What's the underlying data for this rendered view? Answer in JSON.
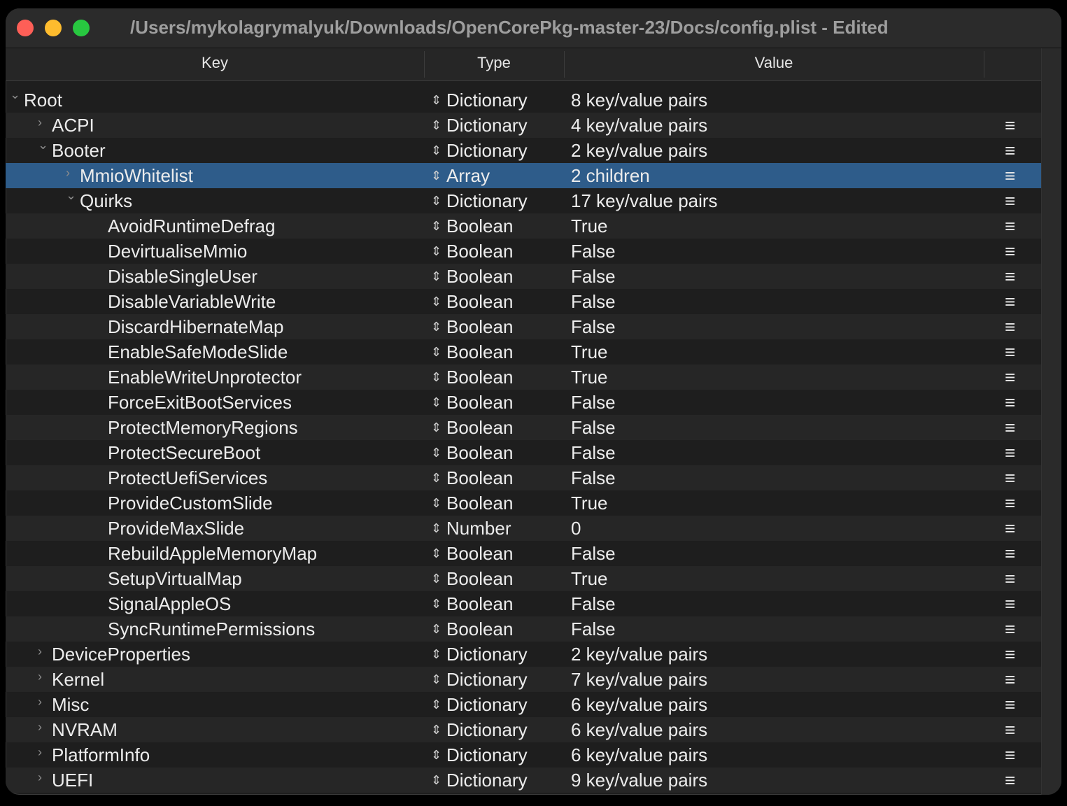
{
  "window": {
    "title": "/Users/mykolagrymalyuk/Downloads/OpenCorePkg-master-23/Docs/config.plist - Edited"
  },
  "columns": {
    "key": "Key",
    "type": "Type",
    "value": "Value"
  },
  "stepper_glyph": "⇕",
  "menu_glyph": "≡",
  "rows": [
    {
      "key": "Root",
      "type": "Dictionary",
      "value": "8 key/value pairs",
      "level": 0,
      "chevron": "⌄",
      "menu": false
    },
    {
      "key": "ACPI",
      "type": "Dictionary",
      "value": "4 key/value pairs",
      "level": 1,
      "chevron": "›",
      "menu": true
    },
    {
      "key": "Booter",
      "type": "Dictionary",
      "value": "2 key/value pairs",
      "level": 1,
      "chevron": "⌄",
      "menu": true
    },
    {
      "key": "MmioWhitelist",
      "type": "Array",
      "value": "2 children",
      "level": 2,
      "chevron": "›",
      "menu": true,
      "selected": true
    },
    {
      "key": "Quirks",
      "type": "Dictionary",
      "value": "17 key/value pairs",
      "level": 2,
      "chevron": "⌄",
      "menu": true
    },
    {
      "key": "AvoidRuntimeDefrag",
      "type": "Boolean",
      "value": "True",
      "level": 3,
      "chevron": "",
      "menu": true
    },
    {
      "key": "DevirtualiseMmio",
      "type": "Boolean",
      "value": "False",
      "level": 3,
      "chevron": "",
      "menu": true
    },
    {
      "key": "DisableSingleUser",
      "type": "Boolean",
      "value": "False",
      "level": 3,
      "chevron": "",
      "menu": true
    },
    {
      "key": "DisableVariableWrite",
      "type": "Boolean",
      "value": "False",
      "level": 3,
      "chevron": "",
      "menu": true
    },
    {
      "key": "DiscardHibernateMap",
      "type": "Boolean",
      "value": "False",
      "level": 3,
      "chevron": "",
      "menu": true
    },
    {
      "key": "EnableSafeModeSlide",
      "type": "Boolean",
      "value": "True",
      "level": 3,
      "chevron": "",
      "menu": true
    },
    {
      "key": "EnableWriteUnprotector",
      "type": "Boolean",
      "value": "True",
      "level": 3,
      "chevron": "",
      "menu": true
    },
    {
      "key": "ForceExitBootServices",
      "type": "Boolean",
      "value": "False",
      "level": 3,
      "chevron": "",
      "menu": true
    },
    {
      "key": "ProtectMemoryRegions",
      "type": "Boolean",
      "value": "False",
      "level": 3,
      "chevron": "",
      "menu": true
    },
    {
      "key": "ProtectSecureBoot",
      "type": "Boolean",
      "value": "False",
      "level": 3,
      "chevron": "",
      "menu": true
    },
    {
      "key": "ProtectUefiServices",
      "type": "Boolean",
      "value": "False",
      "level": 3,
      "chevron": "",
      "menu": true
    },
    {
      "key": "ProvideCustomSlide",
      "type": "Boolean",
      "value": "True",
      "level": 3,
      "chevron": "",
      "menu": true
    },
    {
      "key": "ProvideMaxSlide",
      "type": "Number",
      "value": "0",
      "level": 3,
      "chevron": "",
      "menu": true
    },
    {
      "key": "RebuildAppleMemoryMap",
      "type": "Boolean",
      "value": "False",
      "level": 3,
      "chevron": "",
      "menu": true
    },
    {
      "key": "SetupVirtualMap",
      "type": "Boolean",
      "value": "True",
      "level": 3,
      "chevron": "",
      "menu": true
    },
    {
      "key": "SignalAppleOS",
      "type": "Boolean",
      "value": "False",
      "level": 3,
      "chevron": "",
      "menu": true
    },
    {
      "key": "SyncRuntimePermissions",
      "type": "Boolean",
      "value": "False",
      "level": 3,
      "chevron": "",
      "menu": true
    },
    {
      "key": "DeviceProperties",
      "type": "Dictionary",
      "value": "2 key/value pairs",
      "level": 1,
      "chevron": "›",
      "menu": true
    },
    {
      "key": "Kernel",
      "type": "Dictionary",
      "value": "7 key/value pairs",
      "level": 1,
      "chevron": "›",
      "menu": true
    },
    {
      "key": "Misc",
      "type": "Dictionary",
      "value": "6 key/value pairs",
      "level": 1,
      "chevron": "›",
      "menu": true
    },
    {
      "key": "NVRAM",
      "type": "Dictionary",
      "value": "6 key/value pairs",
      "level": 1,
      "chevron": "›",
      "menu": true
    },
    {
      "key": "PlatformInfo",
      "type": "Dictionary",
      "value": "6 key/value pairs",
      "level": 1,
      "chevron": "›",
      "menu": true
    },
    {
      "key": "UEFI",
      "type": "Dictionary",
      "value": "9 key/value pairs",
      "level": 1,
      "chevron": "›",
      "menu": true
    }
  ]
}
